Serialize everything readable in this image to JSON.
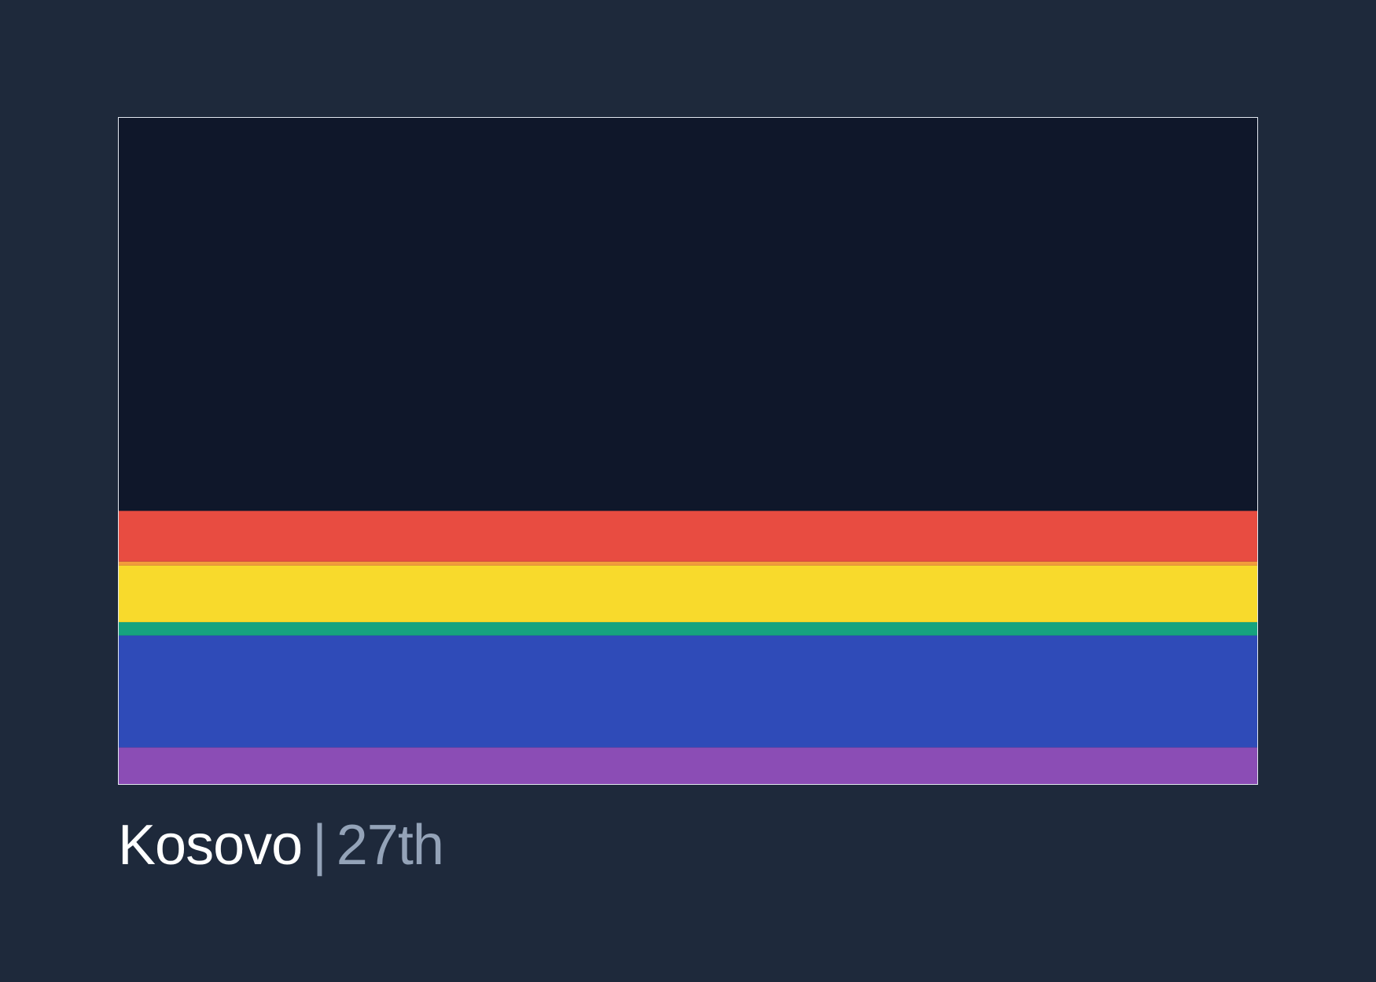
{
  "caption": {
    "country": "Kosovo",
    "separator": "|",
    "rank": "27th"
  },
  "colors": {
    "page_background": "#1e293b",
    "chart_background": "#0f172a",
    "frame_border": "#e2e8f0",
    "country_text": "#ffffff",
    "rank_text": "#94a3b8"
  },
  "chart_data": {
    "type": "bar",
    "orientation": "stacked-vertical",
    "ylim": [
      0,
      100
    ],
    "grid": false,
    "segments": [
      {
        "color": "#8b4db5",
        "value": 5.5
      },
      {
        "color": "#2f4bb8",
        "value": 16.8
      },
      {
        "color": "#16a37f",
        "value": 2.0
      },
      {
        "color": "#f8da2c",
        "value": 8.5
      },
      {
        "color": "#f39c3b",
        "value": 0.6
      },
      {
        "color": "#e84c41",
        "value": 7.6
      }
    ]
  }
}
